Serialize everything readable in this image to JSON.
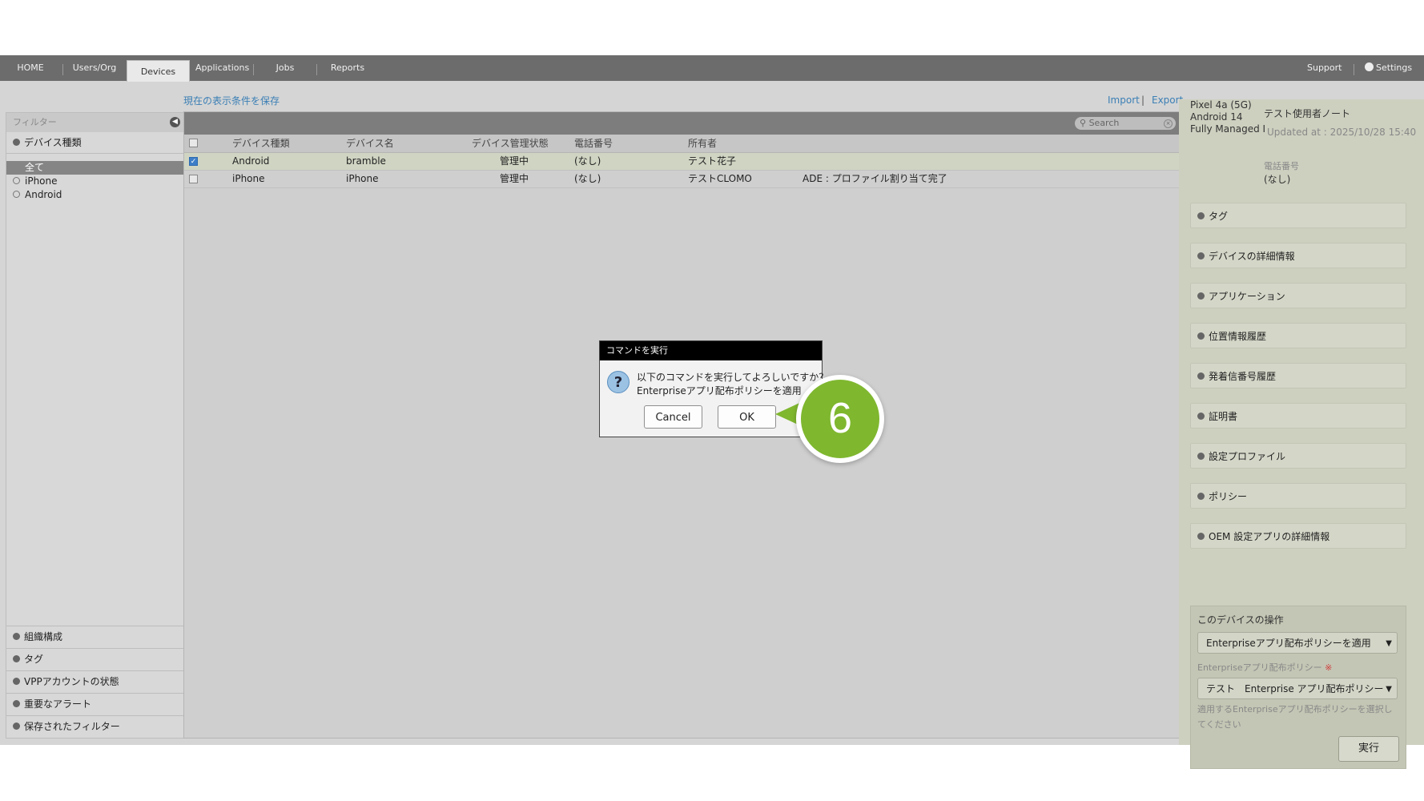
{
  "nav": {
    "tabs": [
      "HOME",
      "Users/Org",
      "Devices",
      "Applications",
      "Jobs",
      "Reports"
    ],
    "active_tab": "Devices",
    "support": "Support",
    "settings": "Settings"
  },
  "top_links": {
    "save_view": "現在の表示条件を保存",
    "import": "Import",
    "sep": "|",
    "export": "Export"
  },
  "sidebar": {
    "header": "フィルター",
    "device_type_section": "デバイス種類",
    "items": [
      "全て",
      "iPhone",
      "Android"
    ],
    "bottom_sections": [
      "組織構成",
      "タグ",
      "VPPアカウントの状態",
      "重要なアラート",
      "保存されたフィルター"
    ]
  },
  "table": {
    "search_placeholder": "Search",
    "columns": [
      "デバイス種類",
      "デバイス名",
      "デバイス管理状態",
      "電話番号",
      "所有者"
    ],
    "rows": [
      {
        "type": "Android",
        "name": "bramble",
        "status": "管理中",
        "phone": "(なし)",
        "owner": "テスト花子",
        "note": "",
        "checked": true
      },
      {
        "type": "iPhone",
        "name": "iPhone",
        "status": "管理中",
        "phone": "(なし)",
        "owner": "テストCLOMO",
        "note": "ADE : プロファイル割り当て完了",
        "checked": false
      }
    ]
  },
  "detail": {
    "model_lines": [
      "Pixel 4a (5G)",
      "Android 14",
      "Fully Managed I"
    ],
    "owner_note": "テスト使用者ノート",
    "updated": "Updated at : 2025/10/28 15:40",
    "phone_label": "電話番号",
    "phone_value": "(なし)",
    "sections": [
      "タグ",
      "デバイスの詳細情報",
      "アプリケーション",
      "位置情報履歴",
      "発着信番号履歴",
      "証明書",
      "設定プロファイル",
      "ポリシー",
      "OEM 設定アプリの詳細情報"
    ],
    "ops": {
      "title": "このデバイスの操作",
      "command_value": "Enterpriseアプリ配布ポリシーを適用",
      "policy_label": "Enterpriseアプリ配布ポリシー",
      "required_mark": "※",
      "policy_value": "テスト　Enterprise アプリ配布ポリシー",
      "hint": [
        "適用するEnterpriseアプリ配布ポリシーを選択し",
        "てください"
      ],
      "execute": "実行"
    }
  },
  "dialog": {
    "title": "コマンドを実行",
    "message_line1": "以下のコマンドを実行してよろしいですか？",
    "message_line2": "Enterpriseアプリ配布ポリシーを適用",
    "cancel": "Cancel",
    "ok": "OK"
  },
  "step": {
    "number": "6",
    "color": "#7fb72f"
  }
}
